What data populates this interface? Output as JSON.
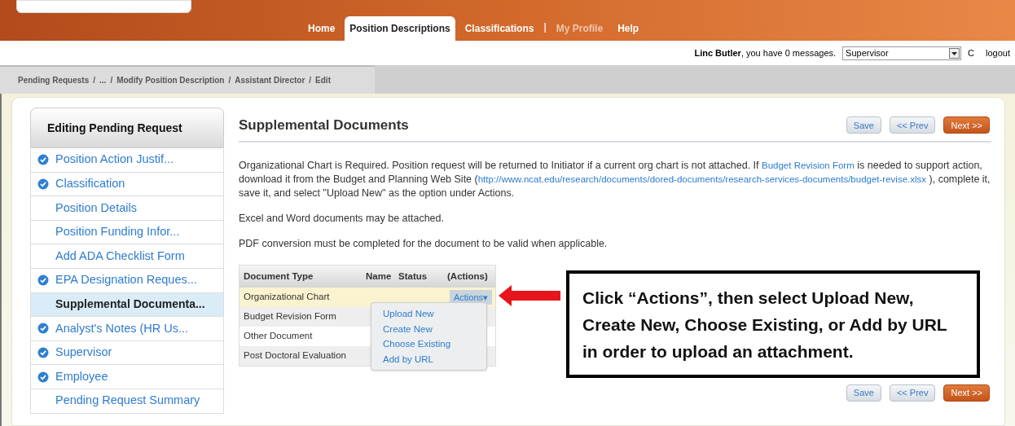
{
  "nav": [
    {
      "kind": "tab",
      "label": "Home",
      "selected": false,
      "disabled": false
    },
    {
      "kind": "tab",
      "label": "Position Descriptions",
      "selected": true,
      "disabled": false
    },
    {
      "kind": "tab",
      "label": "Classifications",
      "selected": false,
      "disabled": false
    },
    {
      "kind": "separator",
      "label": "|"
    },
    {
      "kind": "tab",
      "label": "My Profile",
      "selected": false,
      "disabled": true
    },
    {
      "kind": "tab",
      "label": "Help",
      "selected": false,
      "disabled": false
    }
  ],
  "user_bar": {
    "user": "Linc Butler",
    "message": ", you have 0 messages.",
    "role": "Supervisor",
    "refresh": "C",
    "logout": "logout"
  },
  "breadcrumb": [
    "Pending Requests",
    "...",
    "Modify Position Description",
    "Assistant Director",
    "Edit"
  ],
  "breadcrumb_separator": "/",
  "sidebar": {
    "title": "Editing Pending Request",
    "items": [
      {
        "label": "Position Action Justif...",
        "checked": true,
        "selected": false
      },
      {
        "label": "Classification",
        "checked": true,
        "selected": false
      },
      {
        "label": "Position Details",
        "checked": false,
        "selected": false
      },
      {
        "label": "Position Funding Infor...",
        "checked": false,
        "selected": false
      },
      {
        "label": "Add ADA Checklist Form",
        "checked": false,
        "selected": false
      },
      {
        "label": "EPA Designation Reques...",
        "checked": true,
        "selected": false
      },
      {
        "label": "Supplemental Documenta...",
        "checked": false,
        "selected": true
      },
      {
        "label": "Analyst's Notes (HR Us...",
        "checked": true,
        "selected": false
      },
      {
        "label": "Supervisor",
        "checked": true,
        "selected": false
      },
      {
        "label": "Employee",
        "checked": true,
        "selected": false
      },
      {
        "label": "Pending Request Summary",
        "checked": false,
        "selected": false
      }
    ]
  },
  "content": {
    "title": "Supplemental Documents",
    "buttons": [
      {
        "label": "Save",
        "kind": "plain"
      },
      {
        "label": "<< Prev",
        "kind": "plain"
      },
      {
        "label": "Next >>",
        "kind": "primary"
      }
    ],
    "intro": [
      {
        "text": "Organizational Chart is Required. Position request will be returned to Initiator if a current org chart is not attached. If ",
        "link": false
      },
      {
        "text": "Budget Revision Form",
        "link": true
      },
      {
        "text": " is needed to support action, download it from the Budget and Planning Web Site (",
        "link": false
      },
      {
        "text": "http://www.ncat.edu/research/documents/dored-documents/research-services-documents/budget-revise.xlsx",
        "link": true
      },
      {
        "text": " ), complete it, save it, and select \"Upload New\" as the option under Actions.",
        "link": false
      }
    ],
    "notes": [
      "Excel and Word documents may be attached.",
      "PDF conversion must be completed for the document to be valid when applicable."
    ],
    "table": {
      "columns": [
        "Document Type",
        "Name",
        "Status",
        "(Actions)"
      ],
      "rows": [
        {
          "document_type": "Organizational Chart",
          "selected": true,
          "action": "Actions▾"
        },
        {
          "document_type": "Budget Revision Form",
          "selected": false
        },
        {
          "document_type": "Other Document",
          "selected": false
        },
        {
          "document_type": "Post Doctoral Evaluation",
          "selected": false
        }
      ]
    },
    "actions_menu": [
      "Upload New",
      "Create New",
      "Choose Existing",
      "Add by URL"
    ],
    "bottom_buttons": [
      {
        "label": "Save",
        "kind": "plain"
      },
      {
        "label": "<< Prev",
        "kind": "plain"
      },
      {
        "label": "Next >>",
        "kind": "primary"
      }
    ]
  },
  "callout": "Click “Actions”, then select Upload New, Create New, Choose Existing, or  Add by URL in order to upload an attachment."
}
